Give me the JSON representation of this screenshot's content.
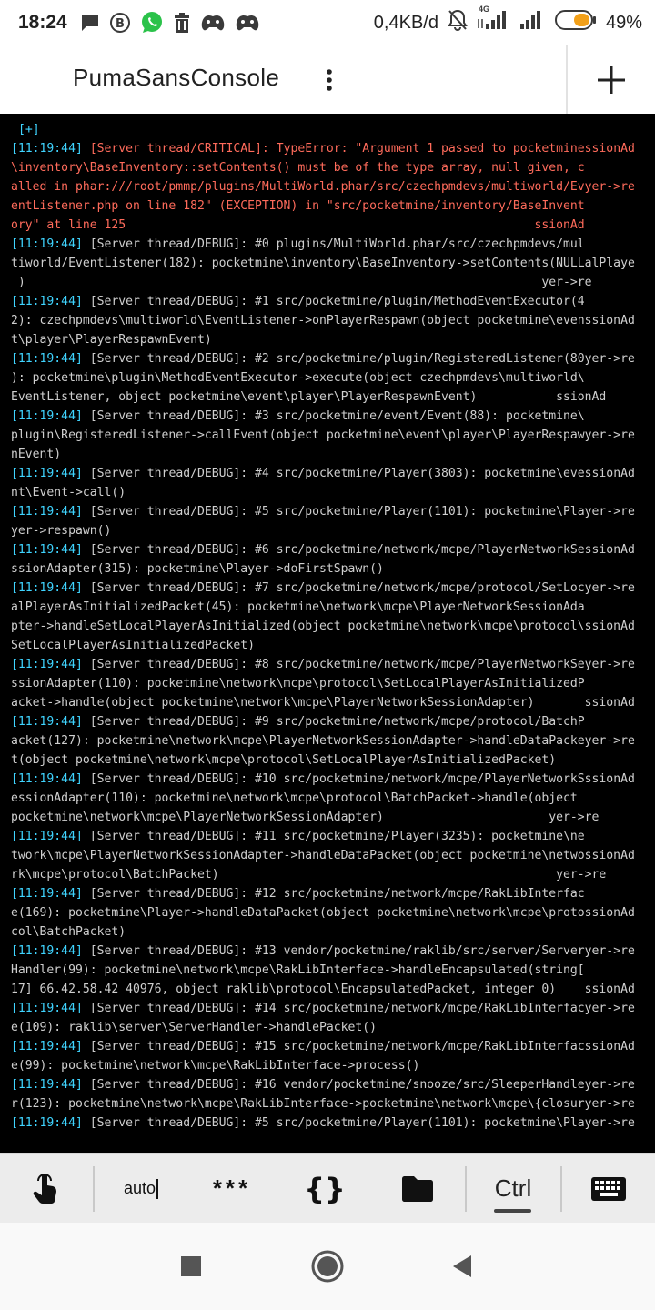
{
  "status_bar": {
    "time": "18:24",
    "net_speed": "0,4KB/d",
    "network_type": "4G",
    "battery_percent": "49%",
    "notification_icons": [
      "chat-icon",
      "b-icon",
      "whatsapp-icon",
      "trash-icon",
      "game-icon",
      "game-icon"
    ]
  },
  "app_bar": {
    "title": "PumaSansConsole"
  },
  "console": {
    "colors": {
      "timestamp": "#3fd4ff",
      "critical": "#ff6b5b",
      "text": "#cfcfcf",
      "background": "#000000"
    },
    "lines": [
      {
        "ts": "",
        "text": "[+]",
        "crit": false
      },
      {
        "ts": "[11:19:44]",
        "text": " [Server thread/CRITICAL]: TypeError: \"Argument 1 passed to pocketminessionAd",
        "crit": true
      },
      {
        "ts": "",
        "text": "\\inventory\\BaseInventory::setContents() must be of the type array, null given, c",
        "crit": true
      },
      {
        "ts": "",
        "text": "alled in phar:///root/pmmp/plugins/MultiWorld.phar/src/czechpmdevs/multiworld/Evyer->re",
        "crit": true
      },
      {
        "ts": "",
        "text": "entListener.php on line 182\" (EXCEPTION) in \"src/pocketmine/inventory/BaseInvent",
        "crit": true
      },
      {
        "ts": "",
        "text": "ory\" at line 125                                                         ssionAd",
        "crit": true
      },
      {
        "ts": "[11:19:44]",
        "text": " [Server thread/DEBUG]: #0 plugins/MultiWorld.phar/src/czechpmdevs/mul",
        "crit": false
      },
      {
        "ts": "",
        "text": "tiworld/EventListener(182): pocketmine\\inventory\\BaseInventory->setContents(NULLalPlaye",
        "crit": false
      },
      {
        "ts": "",
        "text": " )                                                                        yer->re",
        "crit": false
      },
      {
        "ts": "[11:19:44]",
        "text": " [Server thread/DEBUG]: #1 src/pocketmine/plugin/MethodEventExecutor(4",
        "crit": false
      },
      {
        "ts": "",
        "text": "2): czechpmdevs\\multiworld\\EventListener->onPlayerRespawn(object pocketmine\\evenssionAd",
        "crit": false
      },
      {
        "ts": "",
        "text": "t\\player\\PlayerRespawnEvent)",
        "crit": false
      },
      {
        "ts": "[11:19:44]",
        "text": " [Server thread/DEBUG]: #2 src/pocketmine/plugin/RegisteredListener(80yer->re",
        "crit": false
      },
      {
        "ts": "",
        "text": "): pocketmine\\plugin\\MethodEventExecutor->execute(object czechpmdevs\\multiworld\\",
        "crit": false
      },
      {
        "ts": "",
        "text": "EventListener, object pocketmine\\event\\player\\PlayerRespawnEvent)           ssionAd",
        "crit": false
      },
      {
        "ts": "[11:19:44]",
        "text": " [Server thread/DEBUG]: #3 src/pocketmine/event/Event(88): pocketmine\\",
        "crit": false
      },
      {
        "ts": "",
        "text": "plugin\\RegisteredListener->callEvent(object pocketmine\\event\\player\\PlayerRespawyer->re",
        "crit": false
      },
      {
        "ts": "",
        "text": "nEvent)",
        "crit": false
      },
      {
        "ts": "[11:19:44]",
        "text": " [Server thread/DEBUG]: #4 src/pocketmine/Player(3803): pocketmine\\evessionAd",
        "crit": false
      },
      {
        "ts": "",
        "text": "nt\\Event->call()",
        "crit": false
      },
      {
        "ts": "[11:19:44]",
        "text": " [Server thread/DEBUG]: #5 src/pocketmine/Player(1101): pocketmine\\Player->re",
        "crit": false
      },
      {
        "ts": "",
        "text": "yer->respawn()",
        "crit": false
      },
      {
        "ts": "[11:19:44]",
        "text": " [Server thread/DEBUG]: #6 src/pocketmine/network/mcpe/PlayerNetworkSessionAd",
        "crit": false
      },
      {
        "ts": "",
        "text": "ssionAdapter(315): pocketmine\\Player->doFirstSpawn()",
        "crit": false
      },
      {
        "ts": "[11:19:44]",
        "text": " [Server thread/DEBUG]: #7 src/pocketmine/network/mcpe/protocol/SetLocyer->re",
        "crit": false
      },
      {
        "ts": "",
        "text": "alPlayerAsInitializedPacket(45): pocketmine\\network\\mcpe\\PlayerNetworkSessionAda",
        "crit": false
      },
      {
        "ts": "",
        "text": "pter->handleSetLocalPlayerAsInitialized(object pocketmine\\network\\mcpe\\protocol\\ssionAd",
        "crit": false
      },
      {
        "ts": "",
        "text": "SetLocalPlayerAsInitializedPacket)",
        "crit": false
      },
      {
        "ts": "[11:19:44]",
        "text": " [Server thread/DEBUG]: #8 src/pocketmine/network/mcpe/PlayerNetworkSeyer->re",
        "crit": false
      },
      {
        "ts": "",
        "text": "ssionAdapter(110): pocketmine\\network\\mcpe\\protocol\\SetLocalPlayerAsInitializedP",
        "crit": false
      },
      {
        "ts": "",
        "text": "acket->handle(object pocketmine\\network\\mcpe\\PlayerNetworkSessionAdapter)       ssionAd",
        "crit": false
      },
      {
        "ts": "[11:19:44]",
        "text": " [Server thread/DEBUG]: #9 src/pocketmine/network/mcpe/protocol/BatchP",
        "crit": false
      },
      {
        "ts": "",
        "text": "acket(127): pocketmine\\network\\mcpe\\PlayerNetworkSessionAdapter->handleDataPackeyer->re",
        "crit": false
      },
      {
        "ts": "",
        "text": "t(object pocketmine\\network\\mcpe\\protocol\\SetLocalPlayerAsInitializedPacket)",
        "crit": false
      },
      {
        "ts": "[11:19:44]",
        "text": " [Server thread/DEBUG]: #10 src/pocketmine/network/mcpe/PlayerNetworkSssionAd",
        "crit": false
      },
      {
        "ts": "",
        "text": "essionAdapter(110): pocketmine\\network\\mcpe\\protocol\\BatchPacket->handle(object",
        "crit": false
      },
      {
        "ts": "",
        "text": "pocketmine\\network\\mcpe\\PlayerNetworkSessionAdapter)                       yer->re",
        "crit": false
      },
      {
        "ts": "[11:19:44]",
        "text": " [Server thread/DEBUG]: #11 src/pocketmine/Player(3235): pocketmine\\ne",
        "crit": false
      },
      {
        "ts": "",
        "text": "twork\\mcpe\\PlayerNetworkSessionAdapter->handleDataPacket(object pocketmine\\netwossionAd",
        "crit": false
      },
      {
        "ts": "",
        "text": "rk\\mcpe\\protocol\\BatchPacket)                                               yer->re",
        "crit": false
      },
      {
        "ts": "[11:19:44]",
        "text": " [Server thread/DEBUG]: #12 src/pocketmine/network/mcpe/RakLibInterfac",
        "crit": false
      },
      {
        "ts": "",
        "text": "e(169): pocketmine\\Player->handleDataPacket(object pocketmine\\network\\mcpe\\protossionAd",
        "crit": false
      },
      {
        "ts": "",
        "text": "col\\BatchPacket)",
        "crit": false
      },
      {
        "ts": "[11:19:44]",
        "text": " [Server thread/DEBUG]: #13 vendor/pocketmine/raklib/src/server/Serveryer->re",
        "crit": false
      },
      {
        "ts": "",
        "text": "Handler(99): pocketmine\\network\\mcpe\\RakLibInterface->handleEncapsulated(string[",
        "crit": false
      },
      {
        "ts": "",
        "text": "17] 66.42.58.42 40976, object raklib\\protocol\\EncapsulatedPacket, integer 0)    ssionAd",
        "crit": false
      },
      {
        "ts": "[11:19:44]",
        "text": " [Server thread/DEBUG]: #14 src/pocketmine/network/mcpe/RakLibInterfacyer->re",
        "crit": false
      },
      {
        "ts": "",
        "text": "e(109): raklib\\server\\ServerHandler->handlePacket()",
        "crit": false
      },
      {
        "ts": "[11:19:44]",
        "text": " [Server thread/DEBUG]: #15 src/pocketmine/network/mcpe/RakLibInterfacssionAd",
        "crit": false
      },
      {
        "ts": "",
        "text": "e(99): pocketmine\\network\\mcpe\\RakLibInterface->process()",
        "crit": false
      },
      {
        "ts": "[11:19:44]",
        "text": " [Server thread/DEBUG]: #16 vendor/pocketmine/snooze/src/SleeperHandleyer->re",
        "crit": false
      },
      {
        "ts": "",
        "text": "r(123): pocketmine\\network\\mcpe\\RakLibInterface->pocketmine\\network\\mcpe\\{closuryer->re",
        "crit": false
      },
      {
        "ts": "[11:19:44]",
        "text": " [Server thread/DEBUG]: #5 src/pocketmine/Player(1101): pocketmine\\Player->re",
        "crit": false
      }
    ]
  },
  "extra_keys": {
    "touch_icon": "touch-icon",
    "auto_label": "auto",
    "stars_label": "***",
    "braces_label": "{}",
    "folder_icon": "folder-icon",
    "ctrl_label": "Ctrl",
    "keyboard_icon": "keyboard-icon"
  },
  "nav_bar": {
    "buttons": [
      "recents-square-icon",
      "home-circle-icon",
      "back-triangle-icon"
    ]
  }
}
